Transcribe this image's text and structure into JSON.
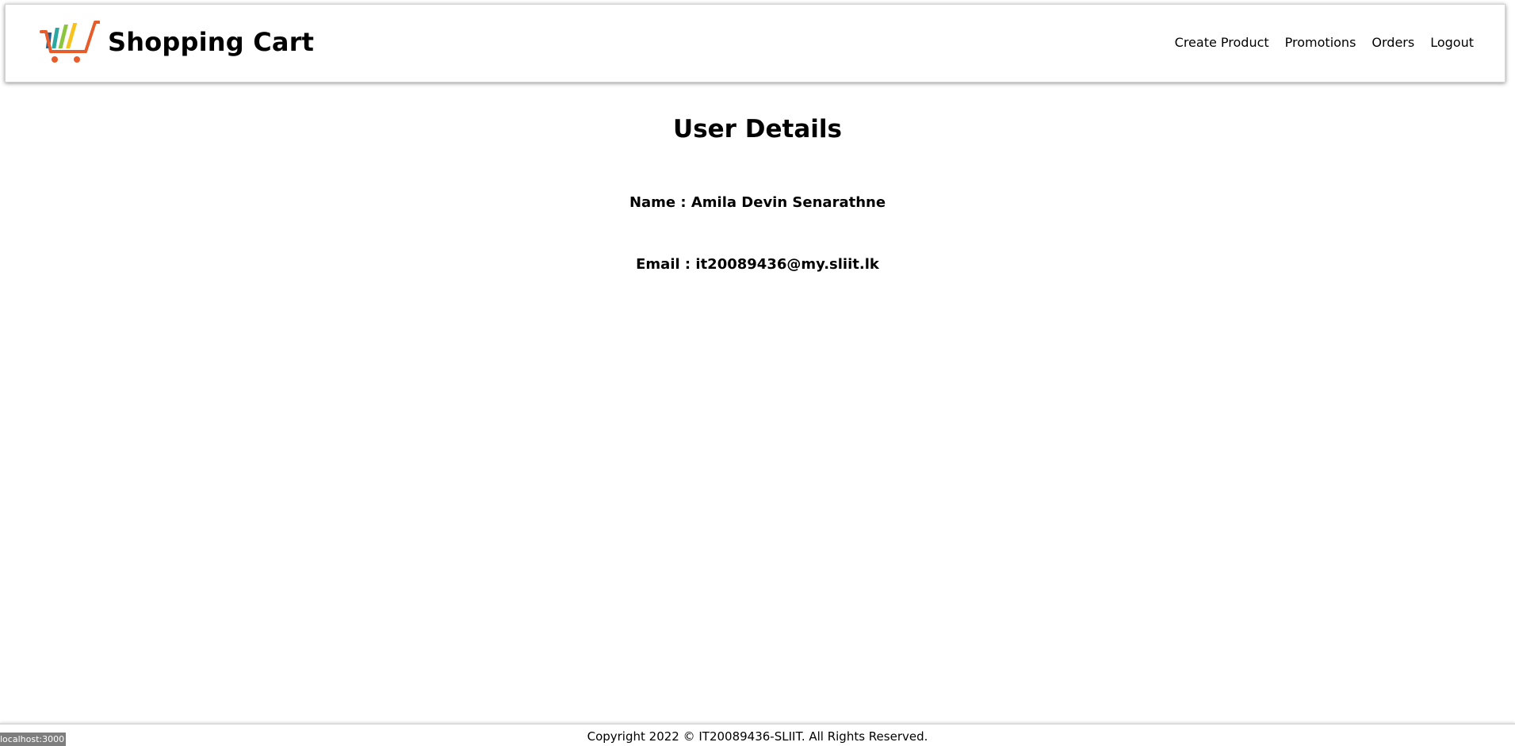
{
  "brand": {
    "title": "Shopping Cart",
    "logo_icon": "shopping-cart-icon",
    "logo_colors": {
      "cart": "#e85c2c",
      "bar1": "#1f5b8f",
      "bar2": "#2aa7a0",
      "bar3": "#8cc63f",
      "bar4": "#f7c21e"
    }
  },
  "nav": {
    "items": [
      {
        "label": "Create Product"
      },
      {
        "label": "Promotions"
      },
      {
        "label": "Orders"
      },
      {
        "label": "Logout"
      }
    ]
  },
  "main": {
    "title": "User Details",
    "name_line": "Name : Amila Devin Senarathne",
    "email_line": "Email : it20089436@my.sliit.lk"
  },
  "footer": {
    "text": "Copyright 2022 © IT20089436-SLIIT. All Rights Reserved."
  },
  "status_bar": {
    "url": "localhost:3000"
  }
}
